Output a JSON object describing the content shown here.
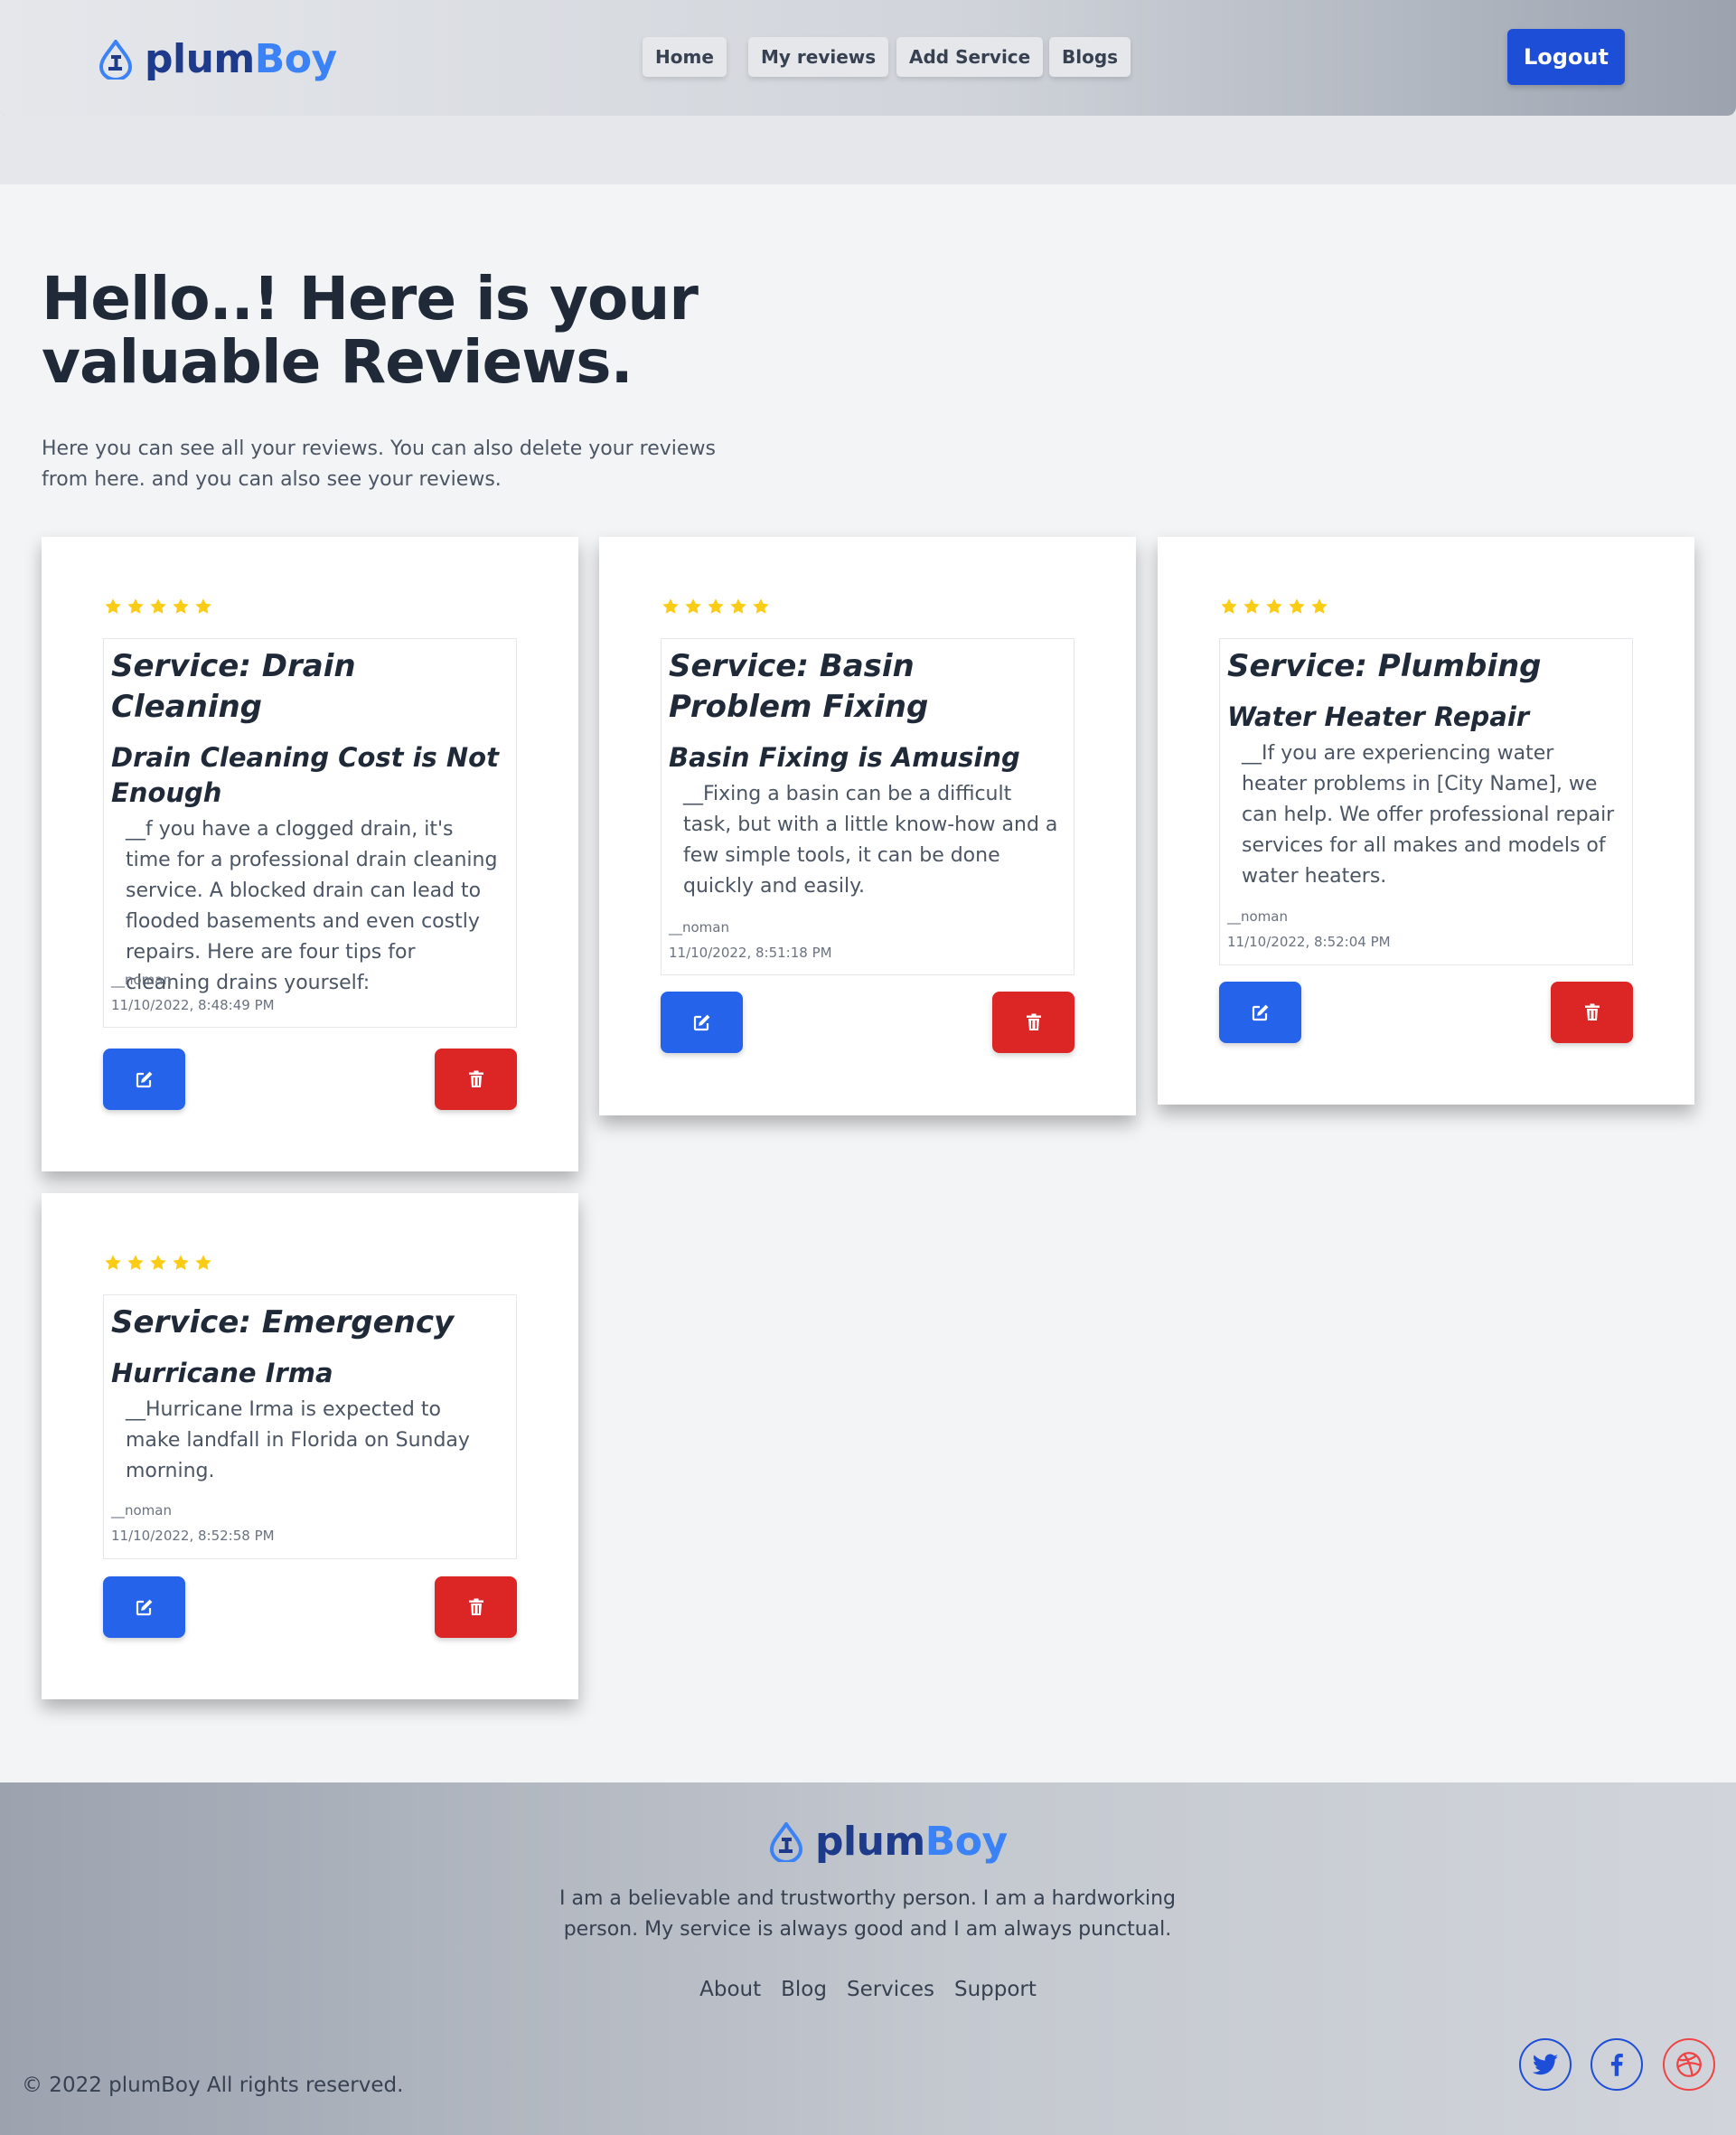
{
  "header": {
    "brand_part1": "plum",
    "brand_part2": "Boy",
    "nav": [
      "Home",
      "My reviews",
      "Add Service",
      "Blogs"
    ],
    "logout_label": "Logout"
  },
  "hero": {
    "title_line1": "Hello..! Here is your",
    "title_line2": "valuable Reviews.",
    "text": "Here you can see all your reviews. You can also delete your reviews from here. and you can also see your reviews."
  },
  "reviews": [
    {
      "rating": 5,
      "service": "Service: Drain Cleaning",
      "title": "Drain Cleaning Cost is Not Enough",
      "body": "__f you have a clogged drain, it's time for a professional drain cleaning service. A blocked drain can lead to flooded basements and even costly repairs. Here are four tips for cleaning drains yourself:",
      "user": "__noman",
      "date": "11/10/2022, 8:48:49 PM"
    },
    {
      "rating": 5,
      "service": "Service: Basin Problem Fixing",
      "title": "Basin Fixing is Amusing",
      "body": "__Fixing a basin can be a difficult task, but with a little know-how and a few simple tools, it can be done quickly and easily.",
      "user": "__noman",
      "date": "11/10/2022, 8:51:18 PM"
    },
    {
      "rating": 5,
      "service": "Service: Plumbing",
      "title": "Water Heater Repair",
      "body": "__If you are experiencing water heater problems in [City Name], we can help. We offer professional repair services for all makes and models of water heaters.",
      "user": "__noman",
      "date": "11/10/2022, 8:52:04 PM"
    },
    {
      "rating": 5,
      "service": "Service: Emergency",
      "title": "Hurricane Irma",
      "body": "__Hurricane Irma is expected to make landfall in Florida on Sunday morning.",
      "user": "__noman",
      "date": "11/10/2022, 8:52:58 PM"
    }
  ],
  "icons": {
    "star": "star-icon",
    "edit": "edit-icon",
    "delete": "trash-icon",
    "logo": "faucet-drop-icon",
    "social": [
      "twitter-icon",
      "facebook-icon",
      "dribbble-icon"
    ]
  },
  "colors": {
    "brand_dark": "#1e3a8a",
    "brand_light": "#3b82f6",
    "edit_button": "#2563eb",
    "delete_button": "#dc2626",
    "star": "#facc15"
  },
  "footer": {
    "brand_part1": "plum",
    "brand_part2": "Boy",
    "text": "I am a believable and trustworthy person. I am a hardworking person. My service is always good and I am always punctual.",
    "links": [
      "About",
      "Blog",
      "Services",
      "Support"
    ],
    "copyright": "© 2022 plumBoy All rights reserved."
  }
}
